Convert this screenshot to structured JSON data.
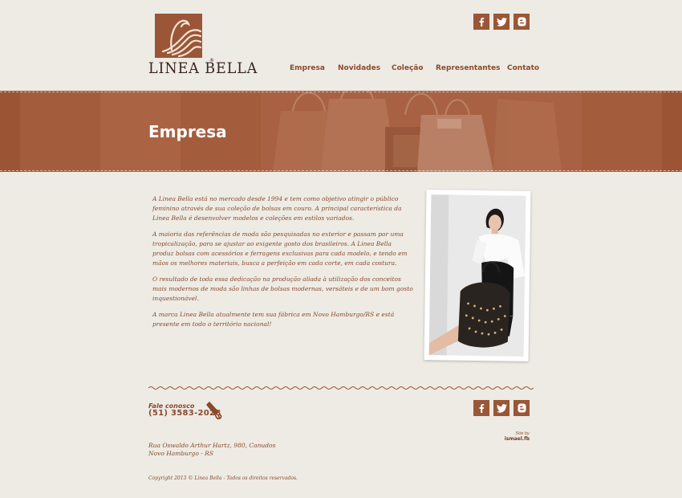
{
  "brand": {
    "name": "LINEA BELLA",
    "reg": "®"
  },
  "colors": {
    "brand": "#9a5637",
    "banner": "#a65f3f",
    "background": "#edebe4",
    "text": "#8a4a2c"
  },
  "social": [
    {
      "icon": "facebook-icon",
      "glyph": "f"
    },
    {
      "icon": "twitter-icon",
      "glyph": "t"
    },
    {
      "icon": "blogger-icon",
      "glyph": "b"
    }
  ],
  "nav": [
    "Empresa",
    "Novidades",
    "Coleção",
    "Representantes",
    "Contato"
  ],
  "banner": {
    "title": "Empresa"
  },
  "content": {
    "paragraphs": [
      "A Linea Bella está no mercado desde 1994 e tem como objetivo atingir o público feminino através de sua coleção de bolsas em couro. A principal característica da Linea Bella é desenvolver modelos e coleções em estilos variados.",
      "A maioria das referências de moda são pesquisadas no exterior e passam por uma tropicalização, para se ajustar ao exigente gosto dos brasileiros. A Linea Bella produz bolsas com acessórios e ferragens exclusivas para cada modelo, e tendo em mãos os melhores materiais, busca a perfeição em cada corte, em cada costura.",
      "O resultado de toda essa dedicação na produção aliada à utilização dos conceitos mais modernos de moda são linhas de bolsas modernas, versáteis e de um bom gosto inquestionável.",
      "A marca Linea Bella atualmente tem sua fábrica em Novo Hamburgo/RS e está presente em todo o território nacional!"
    ]
  },
  "footer": {
    "contact_label": "Fale conosco",
    "phone": "(51) 3583-2028",
    "address_line1": "Rua Oswaldo Arthur Hartz, 980, Canudos",
    "address_line2": "Novo Hamburgo - RS",
    "site_by_label": "Site by",
    "site_by_name": "ismael.fb",
    "copyright": "Copyright 2015 © Linea Bella - Todos os direitos reservados."
  }
}
